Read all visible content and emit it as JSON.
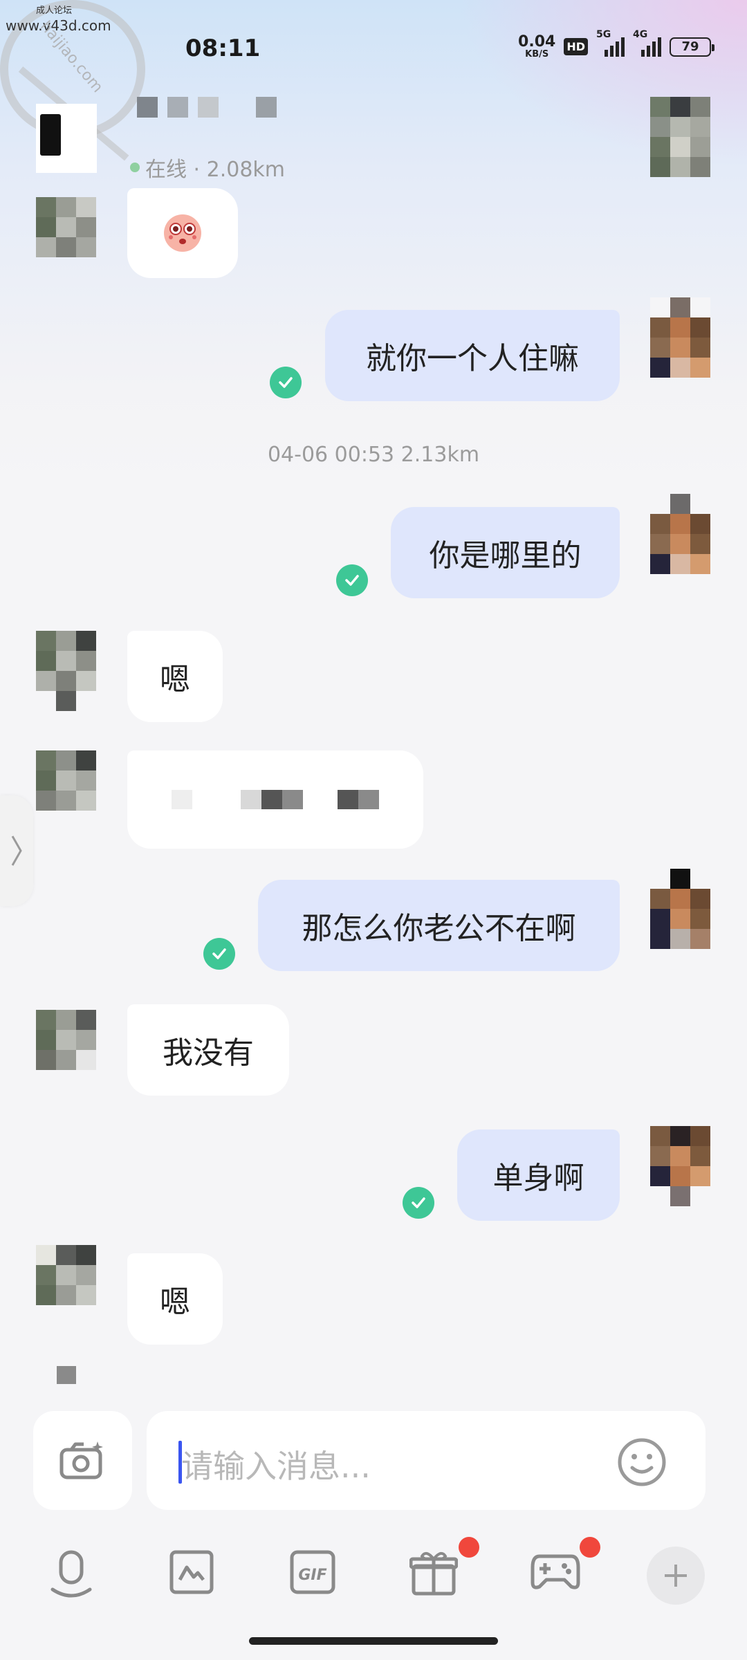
{
  "watermark": {
    "top_text": "成人论坛",
    "url": "www.v43d.com",
    "arc_text": "haijiao.com"
  },
  "status_bar": {
    "time": "08:11",
    "net_speed_value": "0.04",
    "net_speed_unit": "KB/S",
    "hd": "HD",
    "signal1": "5G",
    "signal2": "4G",
    "battery": "79"
  },
  "header": {
    "online_status": "在线 · 2.08km"
  },
  "messages": [
    {
      "side": "in",
      "type": "emoji",
      "emoji": "sad-face"
    },
    {
      "side": "out",
      "text": "就你一个人住嘛",
      "read": true
    },
    {
      "side": "meta",
      "text": "04-06 00:53  2.13km"
    },
    {
      "side": "out",
      "text": "你是哪里的",
      "read": true
    },
    {
      "side": "in",
      "text": "嗯"
    },
    {
      "side": "in",
      "type": "censored"
    },
    {
      "side": "out",
      "text": "那怎么你老公不在啊",
      "read": true
    },
    {
      "side": "in",
      "text": "我没有"
    },
    {
      "side": "out",
      "text": "单身啊",
      "read": true
    },
    {
      "side": "in",
      "text": "嗯"
    }
  ],
  "input": {
    "placeholder": "请输入消息..."
  },
  "toolbar": {
    "items": [
      "voice-icon",
      "image-icon",
      "gif-icon",
      "gift-icon",
      "game-icon",
      "plus-icon"
    ],
    "gif_label": "GIF",
    "badge_color": "#f0473c"
  },
  "colors": {
    "outgoing_bubble": "#dfe6fc",
    "incoming_bubble": "#ffffff",
    "read_tick": "#3ec796",
    "caret": "#3a55f0"
  }
}
